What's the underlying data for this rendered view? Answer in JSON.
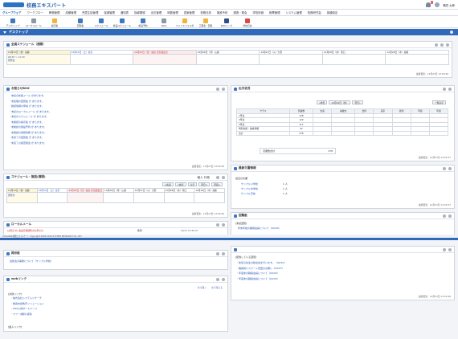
{
  "app": {
    "logo_text": "校務エキスパート",
    "user_name": "職員 太郎",
    "notification_count": "5"
  },
  "menu": [
    "グループウェア",
    "ワークフロー",
    "教務管理",
    "成績管理",
    "児童生徒管理",
    "保健管理",
    "通知表",
    "指導要録",
    "出欠管理",
    "時数管理",
    "週案管理",
    "校務日誌",
    "施設予約",
    "調査・照会",
    "学校評価",
    "帳票管理",
    "システム管理",
    "校務研究会",
    "各種設定"
  ],
  "toolbar": [
    "デスクトップ",
    "ローカルメール",
    "掲示板",
    "",
    "回覧板",
    "スケジュール",
    "施設スケジュール",
    "施設予約",
    "ToDo",
    "ファイルフォルダ",
    "工程表・回覧",
    "Webリンク",
    "学校日誌"
  ],
  "desktop_title": "デスクトップ",
  "schedule_panel": {
    "title": "全員スケジュール（週間）",
    "days": [
      {
        "label": "12月23日（金）先勝",
        "kind": "today",
        "entry": "08:30 ～ 11:30\n研修会"
      },
      {
        "label": "12月24日（土）友引",
        "kind": "sat",
        "entry": ""
      },
      {
        "label": "12月25日（日）先負 天皇誕生日",
        "kind": "hol",
        "entry": ""
      },
      {
        "label": "12月26日（月）仏滅",
        "kind": "",
        "entry": ""
      },
      {
        "label": "12月27日（火）大安",
        "kind": "",
        "entry": ""
      },
      {
        "label": "12月28日（水）赤口",
        "kind": "",
        "entry": ""
      },
      {
        "label": "12月29日（木）先勝",
        "kind": "",
        "entry": ""
      }
    ],
    "updated": "最終更新：12月23日 13:03:46"
  },
  "inbox_panel": {
    "title": "お知らせBOX",
    "items": [
      "未読の新着メール があります。",
      "未処理の回覧板 が あります。",
      "確認依頼の申請 が あります。",
      "未読のローカルメール が あります。",
      "未読のスケジュール が あります。",
      "未確認の掲示板 が あります。",
      "未確認の施設予約 が あります。",
      "未確認の承認依頼 が あります。",
      "未完了の回覧板 が あります。",
      "未完了の調査照会 が あります。"
    ],
    "updated": "最終更新：12月23日 13:03:46"
  },
  "attendance_panel": {
    "title": "出欠状況",
    "nav": [
      "«前日",
      "12月23日（金）",
      "翌日»",
      "一覧表示"
    ],
    "headers": [
      "クラス",
      "児童数",
      "欠席",
      "事故欠",
      "出停",
      "忌引",
      "遅刻",
      "早退",
      "早退"
    ],
    "rows": [
      {
        "label": "1年生",
        "count": "128"
      },
      {
        "label": "2年生",
        "count": "129"
      },
      {
        "label": "3年生",
        "count": "117"
      },
      {
        "label": "特別支援・養成学級",
        "count": "22"
      },
      {
        "label": "合計",
        "count": "378"
      }
    ],
    "total_label": "児童数合計",
    "total_value": "378",
    "updated": "最終更新：12月23日 13:03:47"
  },
  "reference_panel": {
    "title": "最新文書情報",
    "heading": "最近の文書",
    "items": [
      {
        "name": "サンプル小学校",
        "count": "1 人"
      },
      {
        "name": "サンプル中学校",
        "count": "1 人"
      },
      {
        "name": "サンプル高校",
        "count": "1 人"
      }
    ],
    "updated": "最終更新：12月23日 13:03:47"
  },
  "facility_panel": {
    "title": "スケジュール・施設(週間)",
    "select_label": "個人 行政",
    "nav": [
      "<先週",
      "<前日",
      "今日",
      "翌日>",
      "翌週>"
    ],
    "days": [
      {
        "label": "12月23日（金）先勝",
        "kind": "today"
      },
      {
        "label": "12月24日（土）友引",
        "kind": "sat"
      },
      {
        "label": "12月25日（日）先負 天皇誕生日",
        "kind": "hol"
      },
      {
        "label": "12月26日（月）仏滅",
        "kind": ""
      },
      {
        "label": "12月27日（火）大安",
        "kind": ""
      },
      {
        "label": "12月28日（水）赤口",
        "kind": ""
      },
      {
        "label": "12月29日（木）先勝",
        "kind": ""
      }
    ],
    "entry": "研修室",
    "updated": "最終更新：12月23日 13:03:46"
  },
  "local_mail_panel": {
    "title": "ローカルメール",
    "subject": "[お知らせ] 会議日程調整のお知らせ",
    "sender": "教頭",
    "date": "06/21 15:26:07"
  },
  "bulletin_panel": {
    "title": "掲示板",
    "item": "最新会の開催について（サンプル学校）"
  },
  "weblink_panel": {
    "title": "webリンク",
    "tools": [
      "全て開く",
      "全て閉じる"
    ],
    "group1": "[共通リンク]",
    "links": [
      "株式会社システムリサーチ",
      "教員支援教育ソリューション",
      "Web公開ホームページ",
      "ヤフー(無料 検索)"
    ],
    "group2": "[個人リンク]"
  },
  "todo_panel": {
    "title": "回覧板",
    "category": "[未読回覧]",
    "item": "年末年始の職員会議について（09/30）",
    "updated": "最終更新：12月23日 13:03:46"
  },
  "right_bottom_panel": {
    "title": "",
    "category": "[配信している回覧]",
    "items": [
      "新任の先生の歓迎会を行います。（09/30）",
      "職員用パスワード変更のお願い（09/07）",
      "年度末の職員会議について（09/30）",
      "年度末の職員会議について（09/30）"
    ],
    "updated": "最終更新：12月23日 13:03:48"
  },
  "footer": {
    "copyright": "ActiveNet校務エキスパート Copyright 2005-2016 SYSTEM RESEARCH CO.,LTD"
  }
}
